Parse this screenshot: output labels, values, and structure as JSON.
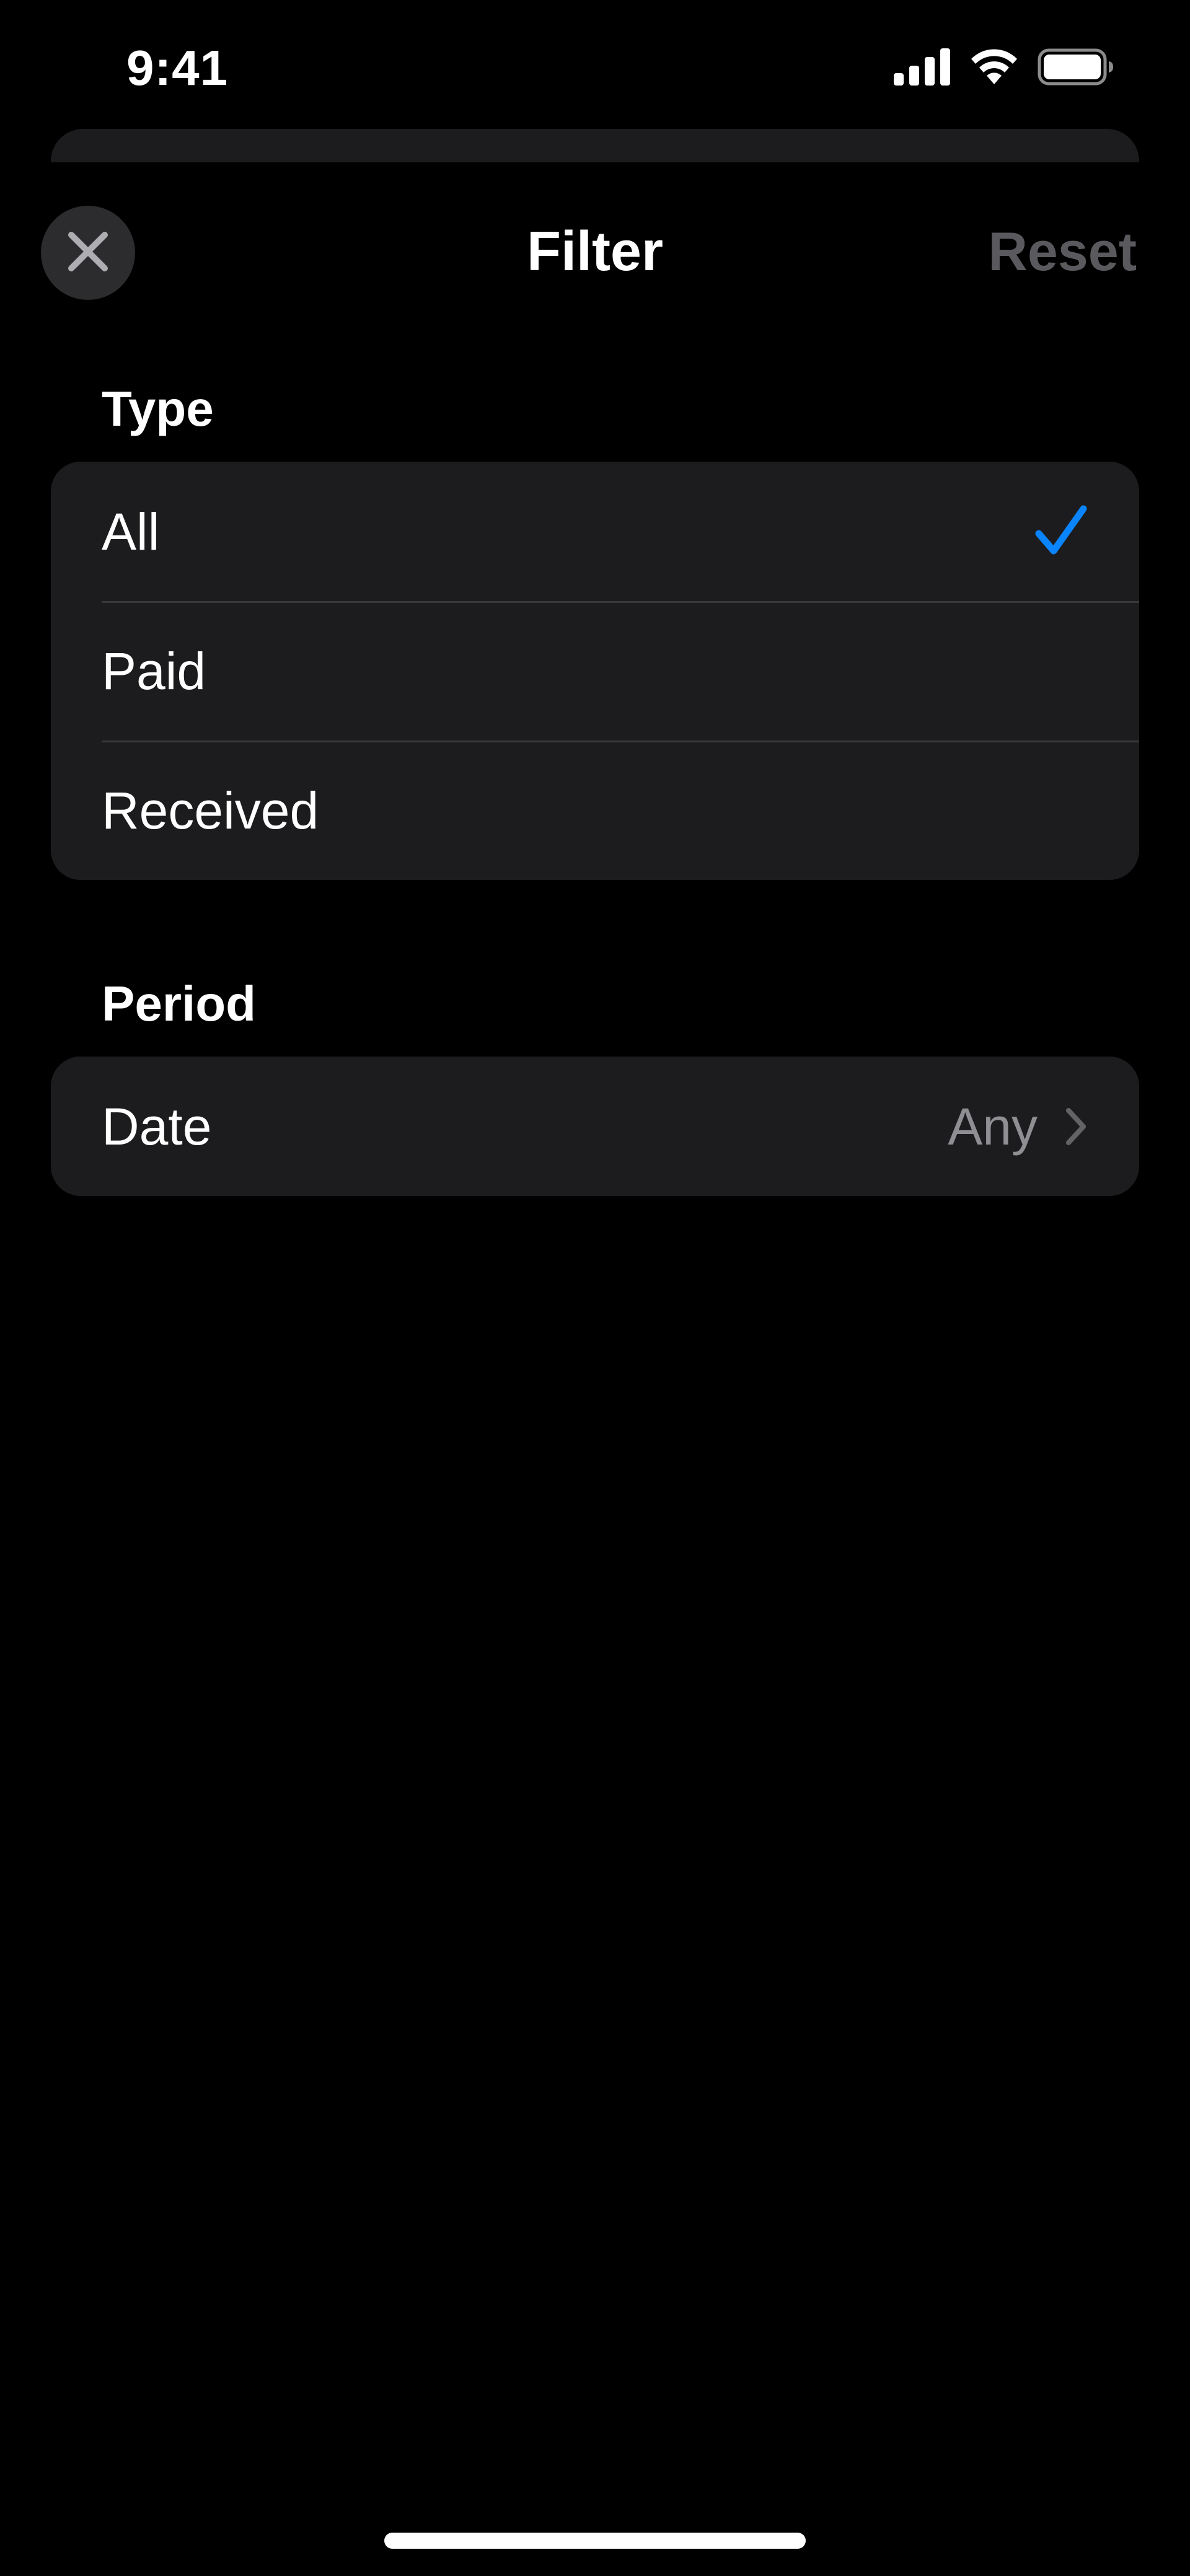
{
  "status_bar": {
    "time": "9:41",
    "icons": [
      "cellular-signal-icon",
      "wifi-icon",
      "battery-icon"
    ]
  },
  "nav": {
    "title": "Filter",
    "reset_label": "Reset",
    "close_icon": "close-icon"
  },
  "type_section": {
    "header": "Type",
    "options": [
      {
        "label": "All",
        "selected": true
      },
      {
        "label": "Paid",
        "selected": false
      },
      {
        "label": "Received",
        "selected": false
      }
    ]
  },
  "period_section": {
    "header": "Period",
    "rows": [
      {
        "label": "Date",
        "value": "Any"
      }
    ]
  },
  "colors": {
    "background": "#000000",
    "card": "#1c1c1e",
    "accent": "#0a84ff",
    "secondary_text": "#8e8e93",
    "disabled_text": "#5a5a5e"
  }
}
